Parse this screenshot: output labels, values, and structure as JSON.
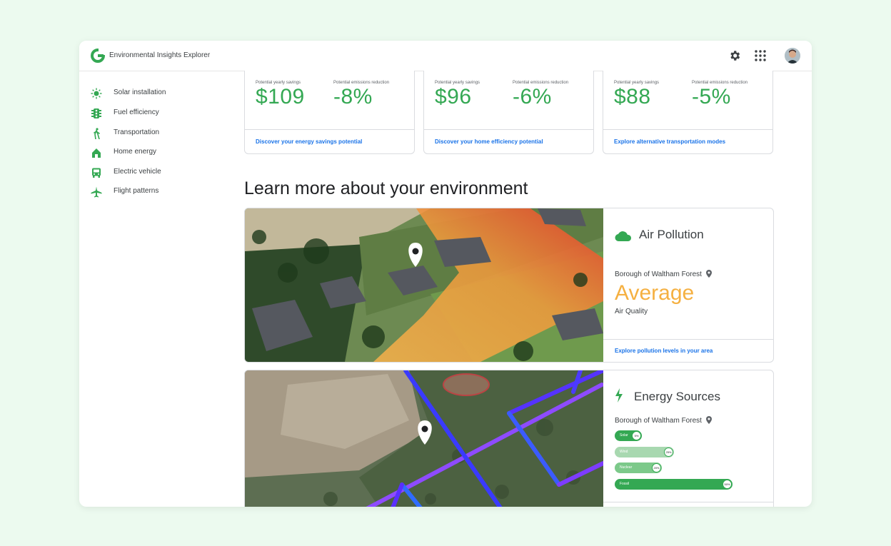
{
  "app": {
    "title": "Environmental Insights Explorer"
  },
  "topbar": {
    "settings_icon": "gear-icon",
    "apps_icon": "grid-icon",
    "avatar": "user-avatar"
  },
  "sidebar": {
    "items": [
      {
        "label": "Solar installation",
        "icon": "sun-icon"
      },
      {
        "label": "Fuel efficiency",
        "icon": "traffic-light-icon"
      },
      {
        "label": "Transportation",
        "icon": "walking-icon"
      },
      {
        "label": "Home energy",
        "icon": "house-icon"
      },
      {
        "label": "Electric vehicle",
        "icon": "bus-icon"
      },
      {
        "label": "Flight patterns",
        "icon": "airplane-icon"
      }
    ]
  },
  "cards": [
    {
      "savings_label": "Potential yearly savings",
      "savings": "$109",
      "emissions_label": "Potential emissions reduction",
      "emissions": "-8%",
      "link": "Discover your energy savings potential"
    },
    {
      "savings_label": "Potential yearly savings",
      "savings": "$96",
      "emissions_label": "Potential emissions reduction",
      "emissions": "-6%",
      "link": "Discover your home efficiency potential"
    },
    {
      "savings_label": "Potential yearly savings",
      "savings": "$88",
      "emissions_label": "Potential emissions reduction",
      "emissions": "-5%",
      "link": "Explore alternative transportation modes"
    }
  ],
  "section": {
    "title": "Learn more about your environment"
  },
  "air": {
    "title": "Air Pollution",
    "location": "Borough of Waltham Forest",
    "level": "Average",
    "metric": "Air Quality",
    "link": "Explore pollution levels in your area",
    "level_color": "#f5b041"
  },
  "energy": {
    "title": "Energy Sources",
    "location": "Borough of Waltham Forest",
    "sources": [
      {
        "label": "Solar",
        "pct_label": "5%",
        "fraction": 0.05
      },
      {
        "label": "Wind",
        "pct_label": "25%",
        "fraction": 0.25
      },
      {
        "label": "Nuclear",
        "pct_label": "20%",
        "fraction": 0.2
      },
      {
        "label": "Fossil",
        "pct_label": "50%",
        "fraction": 0.5
      }
    ]
  },
  "colors": {
    "accent": "#34a853",
    "link": "#1a73e8",
    "background": "#ecfaef"
  }
}
